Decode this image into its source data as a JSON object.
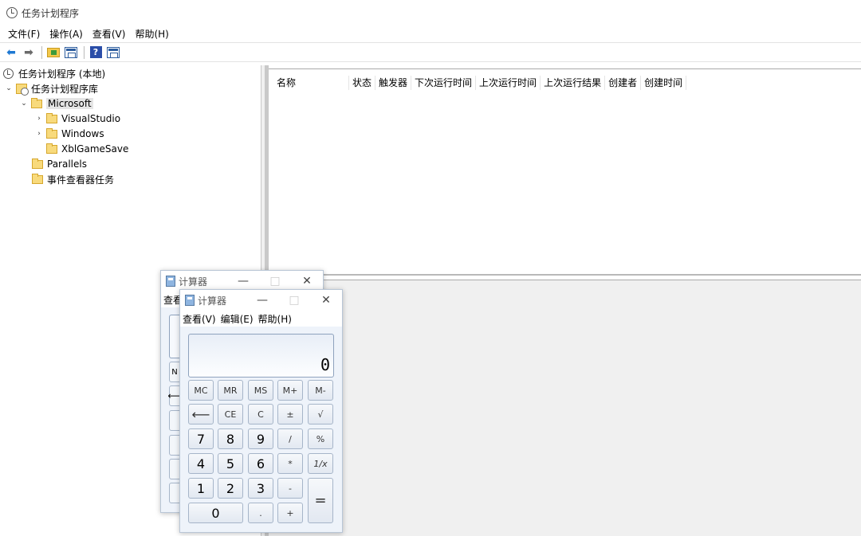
{
  "window": {
    "title": "任务计划程序"
  },
  "menu": [
    "文件(F)",
    "操作(A)",
    "查看(V)",
    "帮助(H)"
  ],
  "tree": {
    "root": "任务计划程序 (本地)",
    "library": "任务计划程序库",
    "microsoft": "Microsoft",
    "visualstudio": "VisualStudio",
    "windows": "Windows",
    "xbl": "XblGameSave",
    "parallels": "Parallels",
    "event_tasks": "事件查看器任务"
  },
  "columns": [
    "名称",
    "状态",
    "触发器",
    "下次运行时间",
    "上次运行时间",
    "上次运行结果",
    "创建者",
    "创建时间"
  ],
  "calc_back": {
    "title": "计算器",
    "menu_partial": "查看",
    "key_partial_m": "N"
  },
  "calc_front": {
    "title": "计算器",
    "menu": [
      "查看(V)",
      "编辑(E)",
      "帮助(H)"
    ],
    "display": "0",
    "keys": {
      "mc": "MC",
      "mr": "MR",
      "ms": "MS",
      "mplus": "M+",
      "mminus": "M-",
      "back": "⟵",
      "ce": "CE",
      "c": "C",
      "pm": "±",
      "sqrt": "√",
      "n7": "7",
      "n8": "8",
      "n9": "9",
      "div": "/",
      "pct": "%",
      "n4": "4",
      "n5": "5",
      "n6": "6",
      "mul": "*",
      "inv": "1/x",
      "n1": "1",
      "n2": "2",
      "n3": "3",
      "sub": "-",
      "eq": "=",
      "n0": "0",
      "dot": ".",
      "add": "+"
    }
  },
  "window_controls": {
    "minimize": "—",
    "maximize": "□",
    "close": "✕"
  }
}
